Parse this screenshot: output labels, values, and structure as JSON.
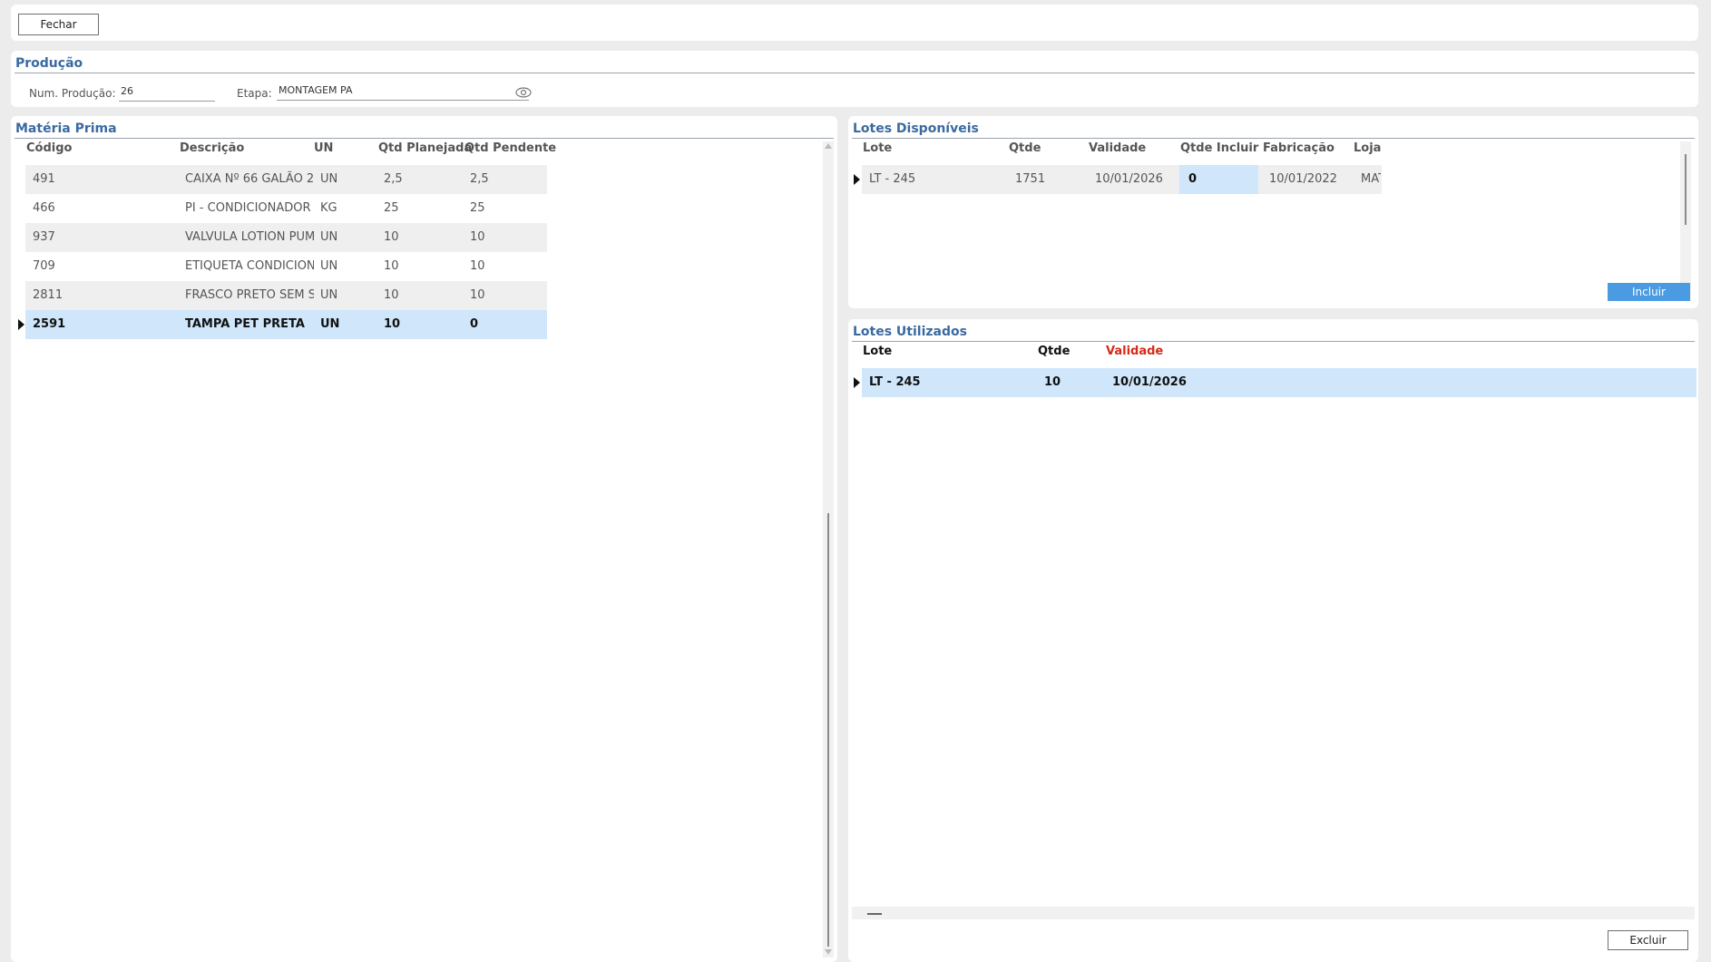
{
  "toolbar": {
    "close_label": "Fechar"
  },
  "producao": {
    "title": "Produção",
    "num_label": "Num. Produção:",
    "num_value": "26",
    "etapa_label": "Etapa:",
    "etapa_value": "MONTAGEM PA"
  },
  "materia_prima": {
    "title": "Matéria Prima",
    "columns": [
      "Código",
      "Descrição",
      "UN",
      "Qtd Planejada",
      "Qtd Pendente"
    ],
    "rows": [
      {
        "codigo": "491",
        "descricao": "CAIXA Nº 66 GALÃO 2",
        "un": "UN",
        "planejada": "2,5",
        "pendente": "2,5"
      },
      {
        "codigo": "466",
        "descricao": "PI - CONDICIONADOR",
        "un": "KG",
        "planejada": "25",
        "pendente": "25"
      },
      {
        "codigo": "937",
        "descricao": "VALVULA LOTION PUMP",
        "un": "UN",
        "planejada": "10",
        "pendente": "10"
      },
      {
        "codigo": "709",
        "descricao": "ETIQUETA CONDICIONADOR",
        "un": "UN",
        "planejada": "10",
        "pendente": "10"
      },
      {
        "codigo": "2811",
        "descricao": "FRASCO PRETO SEM SILK",
        "un": "UN",
        "planejada": "10",
        "pendente": "10"
      },
      {
        "codigo": "2591",
        "descricao": "TAMPA PET PRETA",
        "un": "UN",
        "planejada": "10",
        "pendente": "0"
      }
    ]
  },
  "lotes_disponiveis": {
    "title": "Lotes Disponíveis",
    "columns": [
      "Lote",
      "Qtde",
      "Validade",
      "Qtde Incluir",
      "Fabricação",
      "Loja"
    ],
    "rows": [
      {
        "lote": "LT - 245",
        "qtde": "1751",
        "validade": "10/01/2026",
        "incluir": "0",
        "fabricacao": "10/01/2022",
        "loja": "MAT"
      }
    ],
    "include_label": "Incluir"
  },
  "lotes_utilizados": {
    "title": "Lotes Utilizados",
    "columns": [
      "Lote",
      "Qtde",
      "Validade"
    ],
    "rows": [
      {
        "lote": "LT - 245",
        "qtde": "10",
        "validade": "10/01/2026"
      }
    ],
    "delete_label": "Excluir"
  },
  "colors": {
    "accent_title": "#3a6aa0",
    "selected_row": "#cfe6fb",
    "blue_button": "#4a9be2",
    "validade_header": "#d42a1a"
  }
}
